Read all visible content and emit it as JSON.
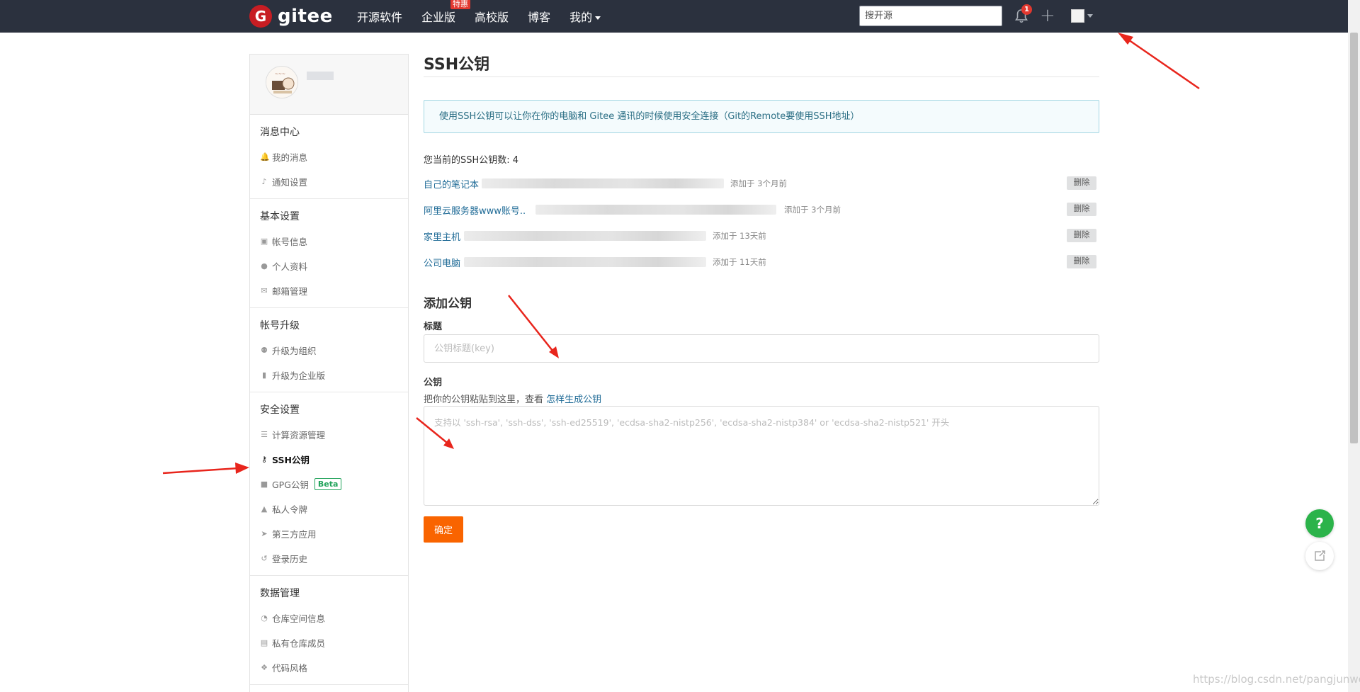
{
  "nav": {
    "logo_mark": "G",
    "logo_text": "gitee",
    "items": [
      {
        "label": "开源软件"
      },
      {
        "label": "企业版",
        "badge": "特惠"
      },
      {
        "label": "高校版"
      },
      {
        "label": "博客"
      },
      {
        "label": "我的"
      }
    ],
    "search_placeholder": "搜开源",
    "notification_count": "1"
  },
  "sidebar": {
    "groups": [
      {
        "title": "消息中心",
        "items": [
          {
            "label": "我的消息",
            "icon": "bell-icon"
          },
          {
            "label": "通知设置",
            "icon": "volume-icon"
          }
        ]
      },
      {
        "title": "基本设置",
        "items": [
          {
            "label": "帐号信息",
            "icon": "id-card-icon"
          },
          {
            "label": "个人资料",
            "icon": "user-icon"
          },
          {
            "label": "邮箱管理",
            "icon": "envelope-icon"
          }
        ]
      },
      {
        "title": "帐号升级",
        "items": [
          {
            "label": "升级为组织",
            "icon": "group-icon"
          },
          {
            "label": "升级为企业版",
            "icon": "building-icon"
          }
        ]
      },
      {
        "title": "安全设置",
        "items": [
          {
            "label": "计算资源管理",
            "icon": "server-icon"
          },
          {
            "label": "SSH公钥",
            "icon": "key-icon",
            "active": true
          },
          {
            "label": "GPG公钥",
            "icon": "lock-icon",
            "badge": "Beta"
          },
          {
            "label": "私人令牌",
            "icon": "token-icon"
          },
          {
            "label": "第三方应用",
            "icon": "rocket-icon"
          },
          {
            "label": "登录历史",
            "icon": "history-icon"
          }
        ]
      },
      {
        "title": "数据管理",
        "items": [
          {
            "label": "仓库空间信息",
            "icon": "pie-chart-icon"
          },
          {
            "label": "私有仓库成员",
            "icon": "lock-box-icon"
          },
          {
            "label": "代码风格",
            "icon": "palette-icon"
          }
        ]
      }
    ]
  },
  "main": {
    "title": "SSH公钥",
    "info": "使用SSH公钥可以让你在你的电脑和 Gitee 通讯的时候使用安全连接（Git的Remote要使用SSH地址）",
    "count_text": "您当前的SSH公钥数: 4",
    "keys": [
      {
        "name": "自己的笔记本",
        "added": "添加于 3个月前",
        "delete_label": "删除"
      },
      {
        "name": "阿里云服务器www账号..",
        "added": "添加于 3个月前",
        "delete_label": "删除"
      },
      {
        "name": "家里主机",
        "added": "添加于 13天前",
        "delete_label": "删除"
      },
      {
        "name": "公司电脑",
        "added": "添加于 11天前",
        "delete_label": "删除"
      }
    ],
    "add_title": "添加公钥",
    "title_label": "标题",
    "title_placeholder": "公钥标题(key)",
    "key_label": "公钥",
    "key_hint": "把你的公钥粘贴到这里，查看 ",
    "key_hint_link": "怎样生成公钥",
    "key_placeholder": "支持以 'ssh-rsa', 'ssh-dss', 'ssh-ed25519', 'ecdsa-sha2-nistp256', 'ecdsa-sha2-nistp384' or 'ecdsa-sha2-nistp521' 开头",
    "submit_label": "确定"
  },
  "float": {
    "help_label": "?"
  },
  "watermark": "https://blog.csdn.net/pangjunwei",
  "colors": {
    "accent": "#f96400",
    "nav_bg": "#2b313e",
    "link": "#1e6a96",
    "annotation_arrow": "#e8251c"
  }
}
